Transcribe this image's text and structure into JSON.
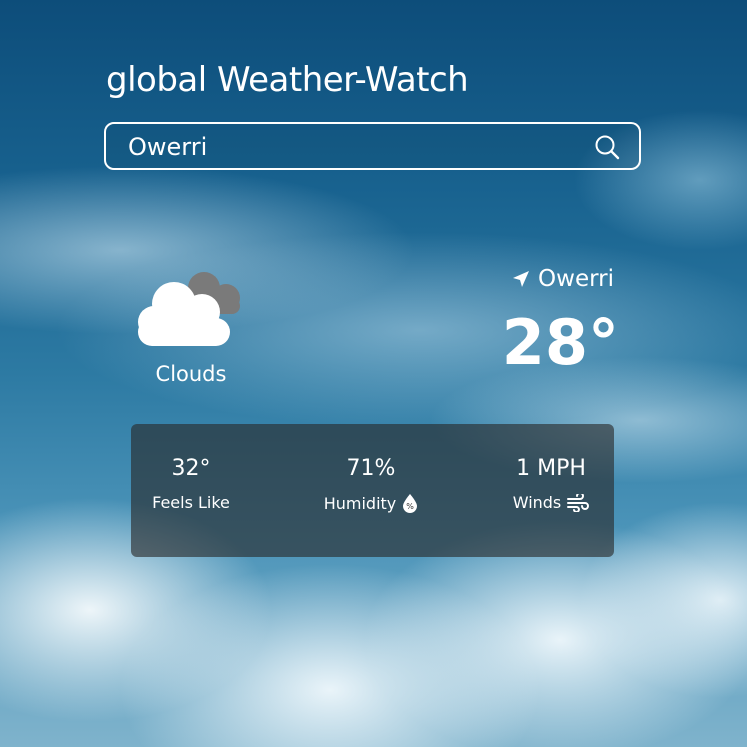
{
  "app": {
    "title": "global Weather-Watch",
    "background": "sky-with-clouds"
  },
  "search": {
    "value": "Owerri",
    "icon": "search-icon"
  },
  "current": {
    "icon": "clouds-icon",
    "condition": "Clouds",
    "location": "Owerri",
    "location_icon": "location-arrow-icon",
    "temperature": "28°"
  },
  "details": {
    "feels_like": {
      "value": "32°",
      "label": "Feels Like"
    },
    "humidity": {
      "value": "71%",
      "label": "Humidity",
      "icon": "humidity-drop-icon"
    },
    "winds": {
      "value": "1 MPH",
      "label": "Winds",
      "icon": "wind-icon"
    }
  },
  "colors": {
    "text": "#ffffff",
    "panel": "#282828",
    "sky_top": "#0d4d7a",
    "cloud_gray": "#7a7a7a"
  }
}
